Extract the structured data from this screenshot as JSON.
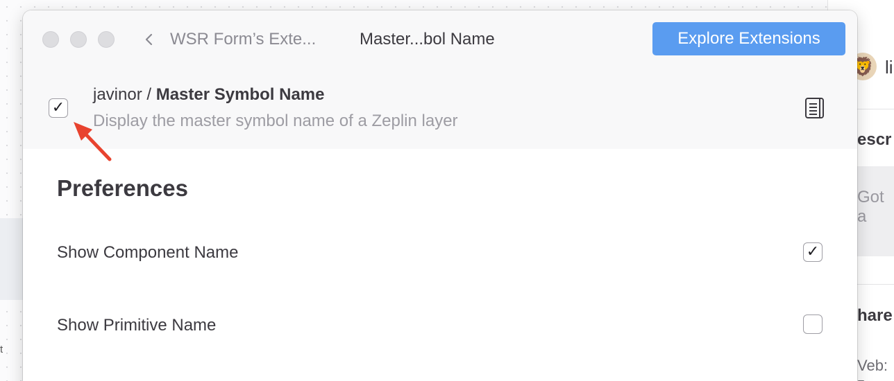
{
  "background": {
    "left_fragment": "t",
    "right_panel": {
      "user_fragment": "li",
      "description_fragment": "escr",
      "comment_fragment": "Got a",
      "share_fragment": "hare",
      "web_fragment": "Veb: z"
    }
  },
  "window": {
    "breadcrumb_parent": "WSR Form’s Exte...",
    "breadcrumb_current": "Master...bol Name",
    "explore_button_label": "Explore Extensions"
  },
  "extension": {
    "enabled": true,
    "author": "javinor",
    "separator": " / ",
    "name": "Master Symbol Name",
    "description": "Display the master symbol name of a Zeplin layer",
    "readme_icon": "document-icon"
  },
  "preferences": {
    "heading": "Preferences",
    "items": [
      {
        "label": "Show Component Name",
        "checked": true
      },
      {
        "label": "Show Primitive Name",
        "checked": false
      }
    ]
  },
  "check_glyph": "✓",
  "colors": {
    "accent": "#5a9cf0",
    "annotation_arrow": "#e8432f"
  }
}
